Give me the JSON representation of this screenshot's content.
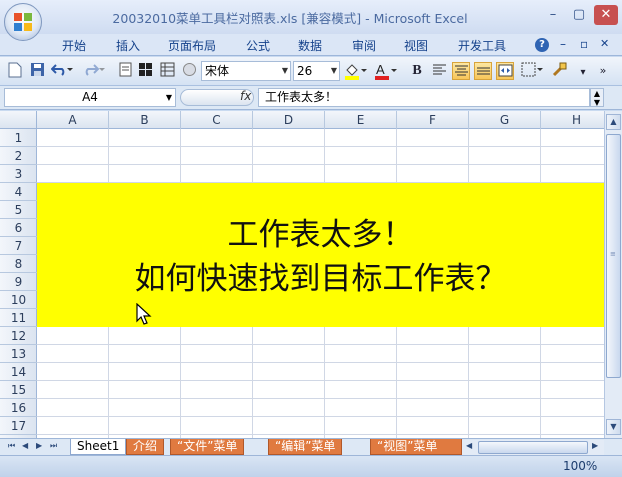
{
  "window": {
    "title": "20032010菜单工具栏对照表.xls [兼容模式] - Microsoft Excel",
    "minimize": "–",
    "maximize": "▢",
    "close": "✕"
  },
  "ribbon": {
    "tabs": [
      "开始",
      "插入",
      "页面布局",
      "公式",
      "数据",
      "审阅",
      "视图",
      "开发工具"
    ],
    "help_icon": "?",
    "doc_min": "–",
    "doc_restore": "▫",
    "doc_close": "✕"
  },
  "toolbar": {
    "font_name": "宋体",
    "font_size": "26",
    "bold": "B",
    "more": "»"
  },
  "formula_bar": {
    "name_box": "A4",
    "fx": "fx",
    "formula": "工作表太多！"
  },
  "grid": {
    "columns": [
      "A",
      "B",
      "C",
      "D",
      "E",
      "F",
      "G",
      "H"
    ],
    "rows": [
      "1",
      "2",
      "3",
      "4",
      "5",
      "6",
      "7",
      "8",
      "9",
      "10",
      "11",
      "12",
      "13",
      "14",
      "15",
      "16",
      "17"
    ],
    "merged_text_line1": "工作表太多！",
    "merged_text_line2": "如何快速找到目标工作表？",
    "fill_color": "#ffff00"
  },
  "sheet_tabs": {
    "nav": [
      "⏮",
      "◀",
      "▶",
      "⏭"
    ],
    "tabs": [
      "Sheet1",
      "介绍",
      "“文件”菜单",
      "“编辑”菜单",
      "“视图”菜单"
    ]
  },
  "status": {
    "zoom": "100%"
  },
  "colors": {
    "accent": "#15428b",
    "tab_orange": "#e07a40"
  }
}
